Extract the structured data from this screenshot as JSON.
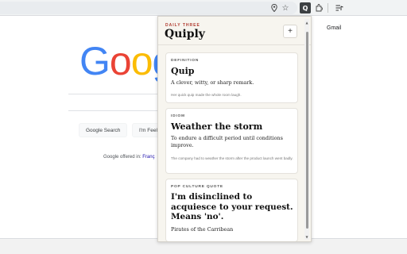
{
  "browser": {
    "icons": [
      "location-icon",
      "star-icon",
      "quiply-extension-icon",
      "extensions-icon",
      "reading-list-icon"
    ],
    "extension_glyph": "Q"
  },
  "google": {
    "gmail_label": "Gmail",
    "logo_letters": [
      "G",
      "o",
      "o",
      "g"
    ],
    "search_button_label": "Google Search",
    "lucky_button_label": "I'm Feel",
    "offered_in_label": "Google offered in:",
    "offered_in_language": "Franç"
  },
  "popup": {
    "eyebrow": "DAILY THREE",
    "title": "Quiply",
    "add_label": "+",
    "cards": [
      {
        "type": "DEFINITION",
        "word": "Quip",
        "definition": "A clever, witty, or sharp remark.",
        "example": "Her quick quip made the whole room laugh."
      },
      {
        "type": "IDIOM",
        "word": "Weather the storm",
        "definition": "To endure a difficult period until conditions improve.",
        "example": "The company had to weather the storm after the product launch went badly."
      },
      {
        "type": "POP CULTURE QUOTE",
        "word": "I'm disinclined to acquiesce to your request. Means 'no'.",
        "definition": "Pirates of the Carribean"
      }
    ]
  }
}
